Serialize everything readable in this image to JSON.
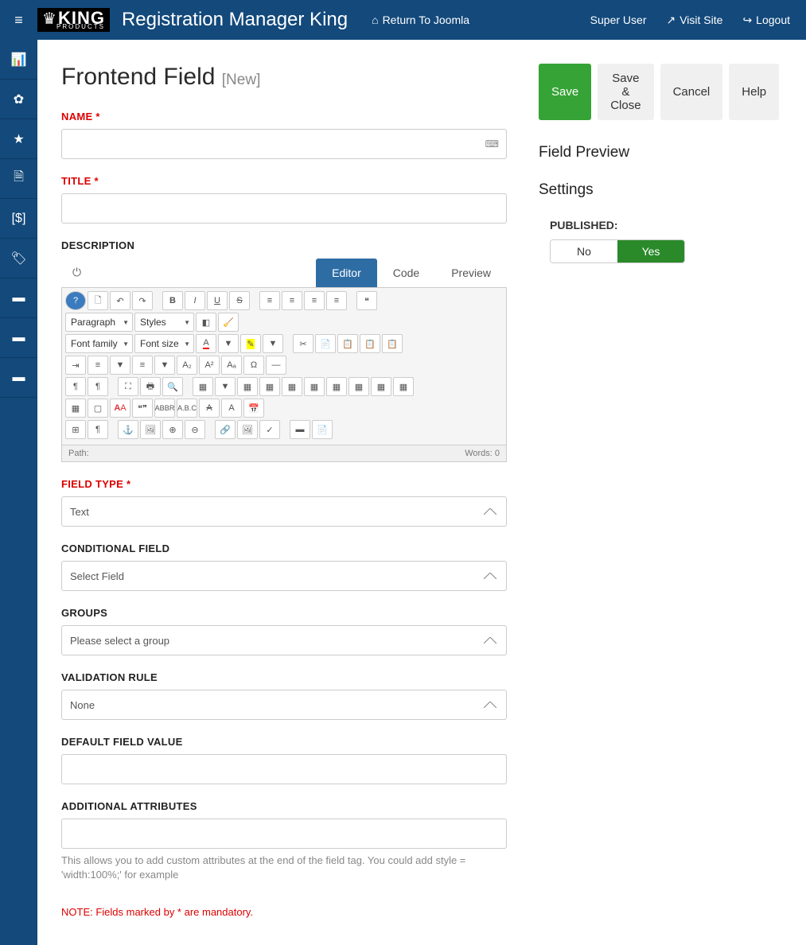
{
  "header": {
    "brand": "Registration Manager King",
    "logo_main": "KING",
    "logo_sub": "PRODUCTS",
    "return_link": "Return To Joomla",
    "user": "Super User",
    "visit_site": "Visit Site",
    "logout": "Logout"
  },
  "page": {
    "title": "Frontend Field",
    "title_sub": "[New]"
  },
  "actions": {
    "save": "Save",
    "save_close": "Save & Close",
    "cancel": "Cancel",
    "help": "Help"
  },
  "form": {
    "name_label": "NAME *",
    "title_label": "TITLE *",
    "description_label": "DESCRIPTION",
    "field_type_label": "FIELD TYPE *",
    "field_type_value": "Text",
    "conditional_label": "CONDITIONAL FIELD",
    "conditional_value": "Select Field",
    "groups_label": "GROUPS",
    "groups_value": "Please select a group",
    "validation_label": "VALIDATION RULE",
    "validation_value": "None",
    "default_label": "DEFAULT FIELD VALUE",
    "attributes_label": "ADDITIONAL ATTRIBUTES",
    "attributes_help": "This allows you to add custom attributes at the end of the field tag. You could add style = 'width:100%;' for example",
    "note": "NOTE: Fields marked by * are mandatory."
  },
  "editor": {
    "tabs": {
      "editor": "Editor",
      "code": "Code",
      "preview": "Preview"
    },
    "selects": {
      "paragraph": "Paragraph",
      "styles": "Styles",
      "font_family": "Font family",
      "font_size": "Font size"
    },
    "status_path": "Path:",
    "status_words": "Words: 0"
  },
  "preview": {
    "field_preview": "Field Preview",
    "settings": "Settings",
    "published_label": "PUBLISHED:",
    "no": "No",
    "yes": "Yes"
  }
}
